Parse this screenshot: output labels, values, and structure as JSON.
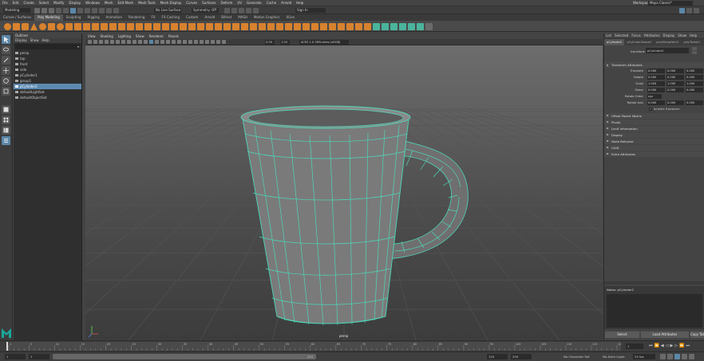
{
  "menubar": {
    "items": [
      "File",
      "Edit",
      "Create",
      "Select",
      "Modify",
      "Display",
      "Windows",
      "Mesh",
      "Edit Mesh",
      "Mesh Tools",
      "Mesh Display",
      "Curves",
      "Surfaces",
      "Deform",
      "UV",
      "Generate",
      "Cache",
      "Arnold",
      "Help"
    ],
    "workspace_label": "Workspace :",
    "workspace_value": "Maya Classic*"
  },
  "statusline": {
    "mode": "Modeling",
    "live_surface": "No Live Surface",
    "symmetry": "Symmetry: Off",
    "sign_in": "Sign In"
  },
  "shelf_tabs": [
    "Curves / Surfaces",
    "Poly Modeling",
    "Sculpting",
    "Rigging",
    "Animation",
    "Rendering",
    "FX",
    "FX Caching",
    "Custom",
    "Arnold",
    "Bifrost",
    "MASH",
    "Motion Graphics",
    "XGen"
  ],
  "shelf_active": "Poly Modeling",
  "outliner": {
    "title": "Outliner",
    "menu": [
      "Display",
      "Show",
      "Help"
    ],
    "items": [
      {
        "label": "persp",
        "indent": 1,
        "selected": false
      },
      {
        "label": "top",
        "indent": 1,
        "selected": false
      },
      {
        "label": "front",
        "indent": 1,
        "selected": false
      },
      {
        "label": "side",
        "indent": 1,
        "selected": false
      },
      {
        "label": "pCylinder1",
        "indent": 1,
        "selected": false
      },
      {
        "label": "group1",
        "indent": 1,
        "selected": false
      },
      {
        "label": "pCylinder2",
        "indent": 1,
        "selected": true
      },
      {
        "label": "defaultLightSet",
        "indent": 1,
        "selected": false
      },
      {
        "label": "defaultObjectSet",
        "indent": 1,
        "selected": false
      }
    ]
  },
  "viewport": {
    "menu": [
      "View",
      "Shading",
      "Lighting",
      "Show",
      "Renderer",
      "Panels"
    ],
    "value_a": "0.00",
    "value_b": "1.00",
    "color_space": "ACES 1.0 SDR-video (sRGB)",
    "camera_label": "persp"
  },
  "attribute_editor": {
    "menu": [
      "List",
      "Selected",
      "Focus",
      "Attributes",
      "Display",
      "Show",
      "Help"
    ],
    "tabs": [
      "pCylinder2",
      "pCylinderShape2",
      "polyMergeVert1",
      "polyTweak1"
    ],
    "transform_label": "transform:",
    "transform_value": "pCylinder2",
    "section_transform": "Transform Attributes",
    "rows": [
      {
        "label": "Translate",
        "values": [
          "0.000",
          "0.000",
          "0.000"
        ]
      },
      {
        "label": "Rotate",
        "values": [
          "0.000",
          "0.000",
          "0.000"
        ]
      },
      {
        "label": "Scale",
        "values": [
          "1.000",
          "1.000",
          "1.000"
        ]
      },
      {
        "label": "Shear",
        "values": [
          "0.000",
          "0.000",
          "0.000"
        ]
      }
    ],
    "rotate_order_label": "Rotate Order",
    "rotate_order_value": "xyz",
    "rotate_axis_label": "Rotate Axis",
    "rotate_axis_values": [
      "0.000",
      "0.000",
      "0.000"
    ],
    "inherits_label": "Inherits Transform",
    "sections_collapsed": [
      "Offset Parent Matrix",
      "Pivots",
      "Limit Information",
      "Display",
      "Node Behavior",
      "UUID",
      "Extra Attributes"
    ],
    "notes_label": "Notes: pCylinder2",
    "buttons": [
      "Select",
      "Load Attributes",
      "Copy Tab"
    ]
  },
  "timeline": {
    "ticks": [
      "1",
      "5",
      "10",
      "15",
      "20",
      "25",
      "30",
      "35",
      "40",
      "45",
      "50",
      "55",
      "60",
      "65",
      "70",
      "75",
      "80",
      "85",
      "90",
      "95",
      "100",
      "105",
      "110",
      "115",
      "120"
    ],
    "current_frame": "1"
  },
  "range": {
    "start": "1",
    "inner_start": "1",
    "inner_end": "120",
    "end_a": "120",
    "end_b": "200",
    "no_character": "No Character Set",
    "no_anim_layer": "No Anim Layer",
    "fps": "24 fps"
  },
  "colors": {
    "selection": "#5d8ab0",
    "mesh_wire": "#4fd6b8",
    "mesh_fill": "#7a7a7a",
    "shelf_icon_orange": "#d8822e"
  }
}
